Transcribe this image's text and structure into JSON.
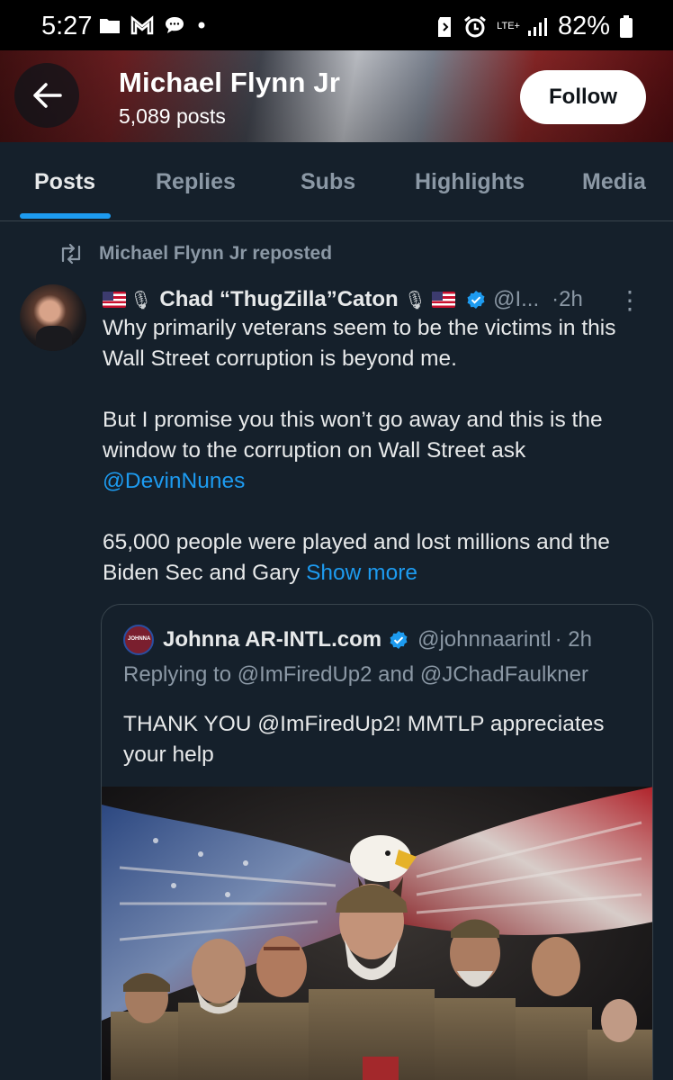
{
  "status_bar": {
    "time": "5:27",
    "network": "LTE+",
    "battery": "82%",
    "left_icons": [
      "gallery-icon",
      "gmail-icon",
      "chat-icon",
      "dot-icon"
    ],
    "right_icons": [
      "sd-card-icon",
      "alarm-icon",
      "signal-icon",
      "battery-icon"
    ]
  },
  "header": {
    "name": "Michael Flynn Jr",
    "posts_count": "5,089 posts",
    "follow_label": "Follow"
  },
  "tabs": [
    {
      "label": "Posts",
      "active": true
    },
    {
      "label": "Replies",
      "active": false
    },
    {
      "label": "Subs",
      "active": false
    },
    {
      "label": "Highlights",
      "active": false
    },
    {
      "label": "Media",
      "active": false
    }
  ],
  "tweet": {
    "repost_label": "Michael Flynn Jr reposted",
    "author_name": "Chad “ThugZilla”Caton",
    "author_handle": "@I...",
    "time": "·2h",
    "body": {
      "p1": "Why primarily veterans seem to be the victims in this Wall Street corruption is beyond me.",
      "p2": "But I promise you this won’t go away and this is the window to the corruption on Wall Street ask",
      "mention": "@DevinNunes",
      "p3": "65,000 people were played and lost millions and the Biden Sec and Gary",
      "show_more": "Show more"
    }
  },
  "quote": {
    "author_name": "Johnna AR-INTL.com",
    "author_handle": "@johnnaarintl",
    "time": "· 2h",
    "reply_to": "Replying to @ImFiredUp2 and @JChadFaulkner",
    "text": "THANK YOU @ImFiredUp2! MMTLP appreciates your help",
    "avatar_text": "JOHNNA"
  },
  "colors": {
    "background": "#15202b",
    "accent": "#1d9bf0",
    "secondary_text": "#8b98a5",
    "border": "#38444d"
  }
}
